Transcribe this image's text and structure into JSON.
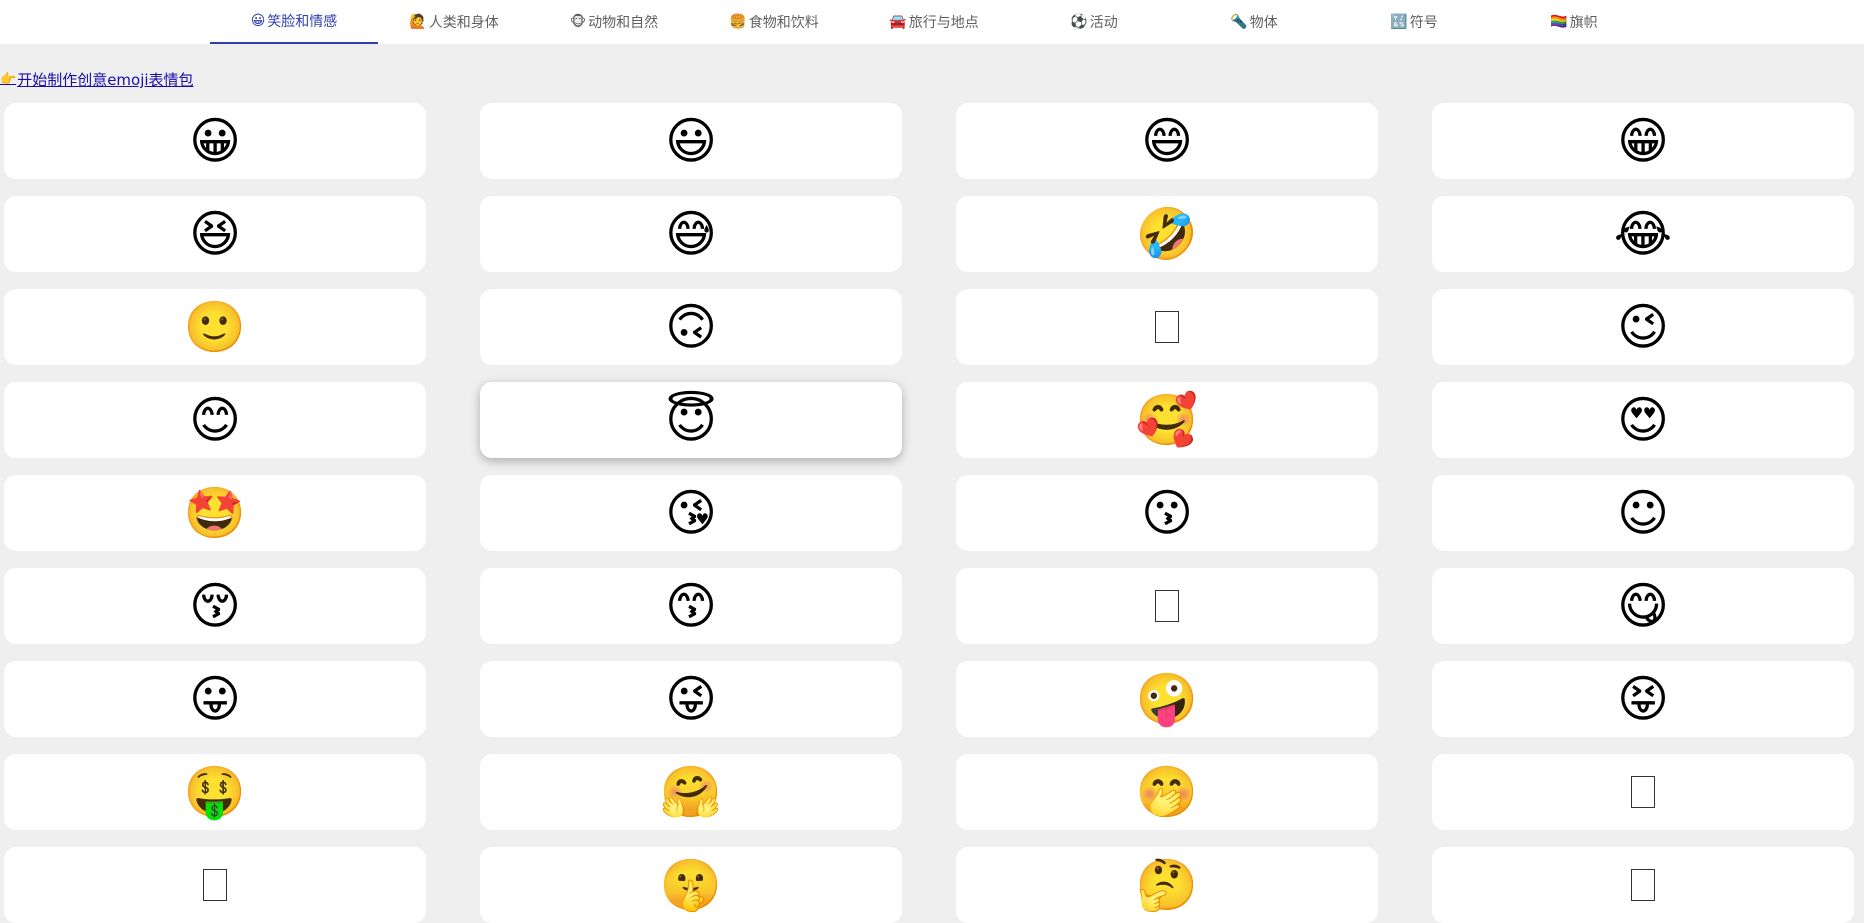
{
  "tabs": [
    {
      "icon": "😀",
      "icon_name": "grinning-face-icon",
      "label": "笑脸和情感",
      "active": true
    },
    {
      "icon": "🙋",
      "icon_name": "person-icon",
      "label": "人类和身体",
      "active": false
    },
    {
      "icon": "🐵",
      "icon_name": "monkey-face-icon",
      "label": "动物和自然",
      "active": false
    },
    {
      "icon": "🍔",
      "icon_name": "burger-icon",
      "label": "食物和饮料",
      "active": false
    },
    {
      "icon": "🚘",
      "icon_name": "car-icon",
      "label": "旅行与地点",
      "active": false
    },
    {
      "icon": "⚽",
      "icon_name": "soccer-ball-icon",
      "label": "活动",
      "active": false
    },
    {
      "icon": "🔦",
      "icon_name": "flashlight-icon",
      "label": "物体",
      "active": false
    },
    {
      "icon": "🔣",
      "icon_name": "symbols-icon",
      "label": "符号",
      "active": false
    },
    {
      "icon": "🏳️‍🌈",
      "icon_name": "rainbow-flag-icon",
      "label": "旗帜",
      "active": false
    }
  ],
  "create_link": {
    "icon": "👉",
    "icon_name": "pointing-hand-icon",
    "label": "开始制作创意emoji表情包"
  },
  "emoji_grid": [
    {
      "char": "😀",
      "name": "grinning-face-icon"
    },
    {
      "char": "😃",
      "name": "grinning-face-big-eyes-icon"
    },
    {
      "char": "😄",
      "name": "grinning-face-smiling-eyes-icon"
    },
    {
      "char": "😁",
      "name": "beaming-face-icon"
    },
    {
      "char": "😆",
      "name": "grinning-squinting-face-icon"
    },
    {
      "char": "😅",
      "name": "grinning-face-sweat-icon"
    },
    {
      "char": "🤣",
      "name": "rolling-on-floor-laughing-icon"
    },
    {
      "char": "😂",
      "name": "face-tears-of-joy-icon"
    },
    {
      "char": "🙂",
      "name": "slightly-smiling-face-icon"
    },
    {
      "char": "🙃",
      "name": "upside-down-face-icon"
    },
    {
      "char": "",
      "name": "missing-glyph-icon",
      "missing": true
    },
    {
      "char": "😉",
      "name": "winking-face-icon"
    },
    {
      "char": "😊",
      "name": "smiling-face-smiling-eyes-icon"
    },
    {
      "char": "😇",
      "name": "smiling-face-halo-icon"
    },
    {
      "char": "🥰",
      "name": "smiling-face-hearts-icon"
    },
    {
      "char": "😍",
      "name": "heart-eyes-face-icon"
    },
    {
      "char": "🤩",
      "name": "star-struck-icon"
    },
    {
      "char": "😘",
      "name": "face-blowing-kiss-icon"
    },
    {
      "char": "😗",
      "name": "kissing-face-icon"
    },
    {
      "char": "☺",
      "name": "smiling-face-icon"
    },
    {
      "char": "😚",
      "name": "kissing-face-closed-eyes-icon"
    },
    {
      "char": "😙",
      "name": "kissing-face-smiling-eyes-icon"
    },
    {
      "char": "",
      "name": "missing-glyph-icon",
      "missing": true
    },
    {
      "char": "😋",
      "name": "face-savoring-food-icon"
    },
    {
      "char": "😛",
      "name": "face-with-tongue-icon"
    },
    {
      "char": "😜",
      "name": "winking-face-tongue-icon"
    },
    {
      "char": "🤪",
      "name": "zany-face-icon"
    },
    {
      "char": "😝",
      "name": "squinting-face-tongue-icon"
    },
    {
      "char": "🤑",
      "name": "money-mouth-face-icon"
    },
    {
      "char": "🤗",
      "name": "hugging-face-icon"
    },
    {
      "char": "🤭",
      "name": "face-hand-over-mouth-icon"
    },
    {
      "char": "",
      "name": "missing-glyph-icon",
      "missing": true
    },
    {
      "char": "",
      "name": "missing-glyph-icon",
      "missing": true
    },
    {
      "char": "🤫",
      "name": "shushing-face-icon"
    },
    {
      "char": "🤔",
      "name": "thinking-face-icon"
    },
    {
      "char": "",
      "name": "missing-glyph-icon",
      "missing": true
    }
  ],
  "colors": {
    "accent": "#2f3fb0",
    "link": "#1a0dab",
    "background": "#efefef",
    "card": "#ffffff"
  }
}
